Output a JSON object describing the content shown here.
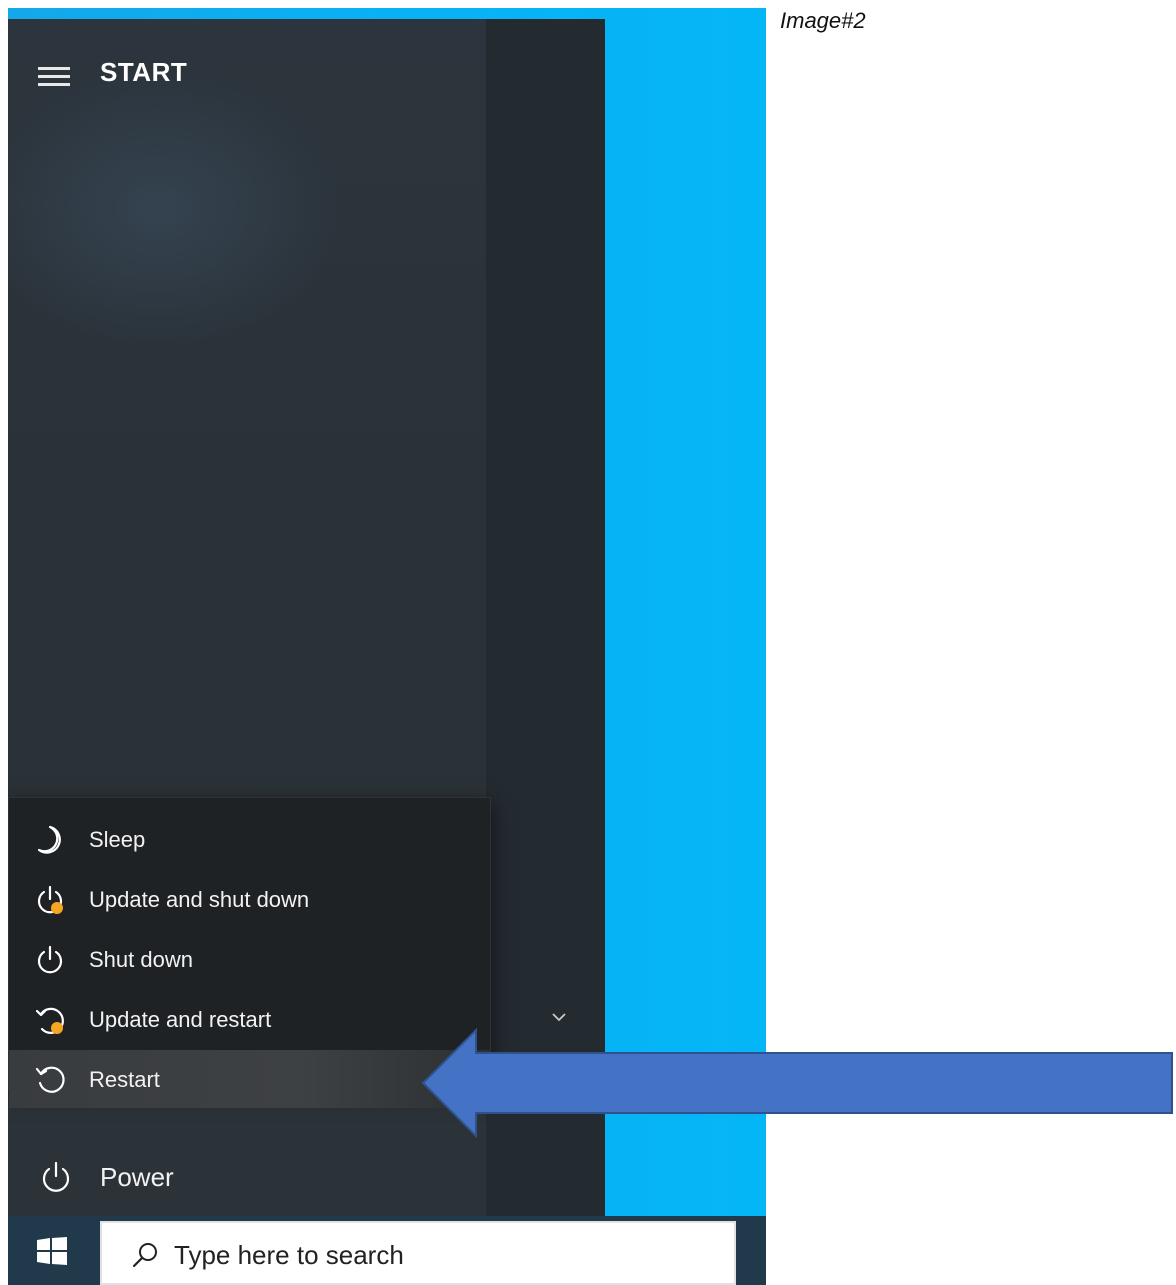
{
  "caption": "Image#2",
  "start_menu": {
    "title": "START",
    "icons": {
      "menu": "hamburger-icon",
      "chevron": "chevron-down-icon"
    }
  },
  "power_options": [
    {
      "label": "Sleep",
      "icon": "sleep-moon-icon"
    },
    {
      "label": "Update and shut down",
      "icon": "update-shutdown-icon"
    },
    {
      "label": "Shut down",
      "icon": "power-icon"
    },
    {
      "label": "Update and restart",
      "icon": "update-restart-icon"
    },
    {
      "label": "Restart",
      "icon": "restart-icon",
      "selected": true
    }
  ],
  "power_button": {
    "label": "Power",
    "icon": "power-icon"
  },
  "taskbar": {
    "start_icon": "windows-logo-icon",
    "search_placeholder": "Type here to search",
    "search_icon": "search-icon"
  },
  "colors": {
    "desktop": "#08b2f5",
    "menu_bg": "#2a3139",
    "flyout_bg": "#1f2225",
    "taskbar": "#203a4c",
    "update_badge": "#f5a623",
    "arrow_fill": "#4472c4",
    "arrow_stroke": "#2f528f"
  }
}
